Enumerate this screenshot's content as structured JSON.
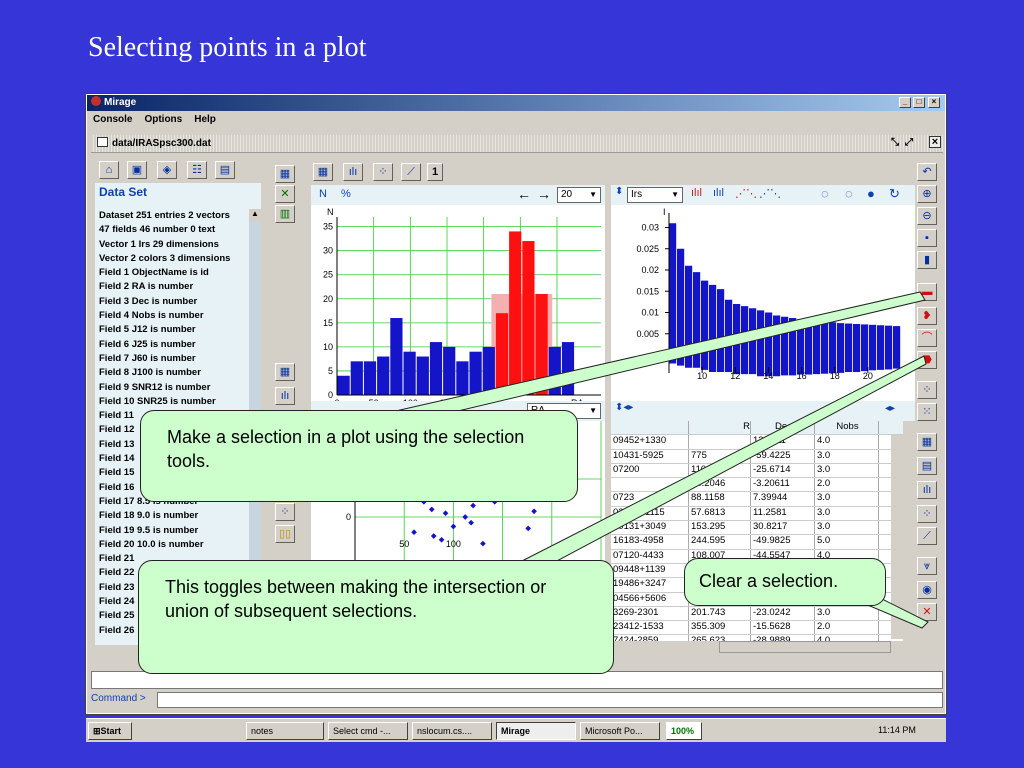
{
  "slide": {
    "title": "Selecting points in a plot"
  },
  "window": {
    "title": "Mirage",
    "menu": [
      "Console",
      "Options",
      "Help"
    ],
    "doc_title": "data/IRASpsc300.dat"
  },
  "dataset": {
    "header": "Data Set",
    "lines": [
      "Dataset 251 entries 2 vectors",
      "47 fields 46 number 0 text",
      "Vector 1 Irs 29 dimensions",
      "Vector 2 colors 3 dimensions",
      "Field 1 ObjectName  is id",
      "Field 2 RA  is number",
      "Field 3 Dec  is number",
      "Field 4 Nobs  is number",
      "Field 5 J12  is number",
      "Field 6 J25  is number",
      "Field 7 J60  is number",
      "Field 8 J100  is number",
      "Field 9 SNR12  is number",
      "Field 10 SNR25  is number",
      "Field 11",
      "Field 12",
      "Field 13",
      "Field 14",
      "Field 15",
      "Field 16",
      "Field 17 8.5  is number",
      "Field 18 9.0  is number",
      "Field 19 9.5  is number",
      "Field 20 10.0  is number",
      "Field 21",
      "Field 22",
      "Field 23",
      "Field 24",
      "Field 25",
      "Field 26"
    ]
  },
  "tabs": {
    "page_num": "1"
  },
  "hist": {
    "n_label": "N",
    "pct_label": "%",
    "bins": "20",
    "ylabel": "N",
    "xlabel": "RA"
  },
  "irs": {
    "select": "Irs",
    "ylabel": "I"
  },
  "scatter": {
    "select": "RA",
    "xlabel": "RA"
  },
  "table": {
    "columns": [
      "Dec",
      "Nobs"
    ],
    "header_partial": "R",
    "rows": [
      [
        "09452+1330",
        "",
        "13.5111",
        "4.0"
      ],
      [
        "10431-5925",
        "775",
        "-59.4225",
        "3.0"
      ],
      [
        "07200",
        "110.232",
        "-25.6714",
        "3.0"
      ],
      [
        "",
        "34.2046",
        "-3.20611",
        "2.0"
      ],
      [
        "0723",
        "88.1158",
        "7.39944",
        "3.0"
      ],
      [
        "03507+1115",
        "57.6813",
        "11.2581",
        "3.0"
      ],
      [
        "10131+3049",
        "153.295",
        "30.8217",
        "3.0"
      ],
      [
        "16183-4958",
        "244.595",
        "-49.9825",
        "5.0"
      ],
      [
        "07120-4433",
        "108.007",
        "-44.5547",
        "4.0"
      ],
      [
        "09448+1139",
        "",
        "",
        ""
      ],
      [
        "19486+3247",
        "",
        "",
        ""
      ],
      [
        "04566+5606",
        "",
        "",
        ""
      ],
      [
        "3269-2301",
        "201.743",
        "-23.0242",
        "3.0"
      ],
      [
        "23412-1533",
        "355.309",
        "-15.5628",
        "2.0"
      ],
      [
        "7424-2859",
        "265.623",
        "-28.9889",
        "4.0"
      ]
    ]
  },
  "command": {
    "label": "Command >"
  },
  "callouts": {
    "selection": "Make a selection in a plot using the selection tools.",
    "toggle": "This toggles between making the intersection or union of subsequent selections.",
    "clear": "Clear a selection."
  },
  "taskbar": {
    "start": "Start",
    "items": [
      "notes",
      "Select cmd -...",
      "nslocum.cs....",
      "Mirage",
      "Microsoft Po..."
    ],
    "zoom": "100%",
    "clock": "11:14 PM"
  },
  "chart_data": [
    {
      "type": "bar",
      "ylabel": "N",
      "xlabel": "RA",
      "ylim": [
        0,
        37
      ],
      "xlim": [
        0,
        360
      ],
      "yticks": [
        0,
        5,
        10,
        15,
        20,
        25,
        30,
        35
      ],
      "xticks": [
        0,
        50,
        100,
        150,
        200
      ],
      "bin_width": 18,
      "values": [
        4,
        7,
        7,
        8,
        16,
        9,
        8,
        11,
        10,
        7,
        9,
        10,
        17,
        34,
        32,
        21,
        10,
        11
      ],
      "selected": [
        0,
        0,
        0,
        0,
        0,
        0,
        0,
        0,
        0,
        0,
        0,
        0,
        1,
        1,
        1,
        1,
        0,
        0
      ],
      "colors": {
        "normal": "#1414c8",
        "selected": "#ff1010",
        "highlight": "#f4b0b0"
      }
    },
    {
      "type": "bar",
      "ylabel": "I",
      "ylim": [
        0,
        0.032
      ],
      "xlim": [
        8,
        22
      ],
      "yticks": [
        0,
        0.005,
        0.01,
        0.015,
        0.02,
        0.025,
        0.03
      ],
      "ytick_labels": [
        "0",
        "0.005",
        "0.01",
        "0.015",
        "0.02",
        "0.025",
        "0.03"
      ],
      "xticks": [
        10,
        12,
        14,
        16,
        18,
        20
      ],
      "values_pos": [
        0.031,
        0.025,
        0.021,
        0.0195,
        0.0175,
        0.0165,
        0.0155,
        0.013,
        0.012,
        0.0115,
        0.011,
        0.0105,
        0.01,
        0.0093,
        0.009,
        0.0087,
        0.0084,
        0.0082,
        0.008,
        0.0078,
        0.0077,
        0.0075,
        0.0074,
        0.0073,
        0.0072,
        0.0071,
        0.007,
        0.0069,
        0.0068
      ],
      "values_neg": [
        0.002,
        0.0025,
        0.003,
        0.003,
        0.0035,
        0.004,
        0.004,
        0.004,
        0.0045,
        0.0045,
        0.0045,
        0.005,
        0.005,
        0.005,
        0.0048,
        0.0048,
        0.0046,
        0.0046,
        0.0045,
        0.0044,
        0.0043,
        0.0042,
        0.004,
        0.004,
        0.0038,
        0.0036,
        0.0035,
        0.0034,
        0.0032
      ],
      "color": "#1414c8"
    },
    {
      "type": "scatter",
      "xlabel": "RA",
      "yticks": [
        20,
        0
      ],
      "xticks": [
        50,
        100
      ],
      "x": [
        55,
        62,
        70,
        78,
        85,
        92,
        100,
        108,
        120,
        135,
        150,
        168,
        182,
        195,
        60,
        74,
        88,
        104,
        118,
        142,
        160,
        176,
        66,
        80,
        96,
        112,
        130,
        148
      ],
      "y": [
        30,
        12,
        8,
        4,
        18,
        2,
        -5,
        14,
        6,
        22,
        10,
        26,
        3,
        16,
        -8,
        24,
        -12,
        20,
        -3,
        8,
        28,
        -6,
        20,
        -10,
        27,
        0,
        -14,
        15
      ],
      "color": "#1414c8"
    }
  ]
}
